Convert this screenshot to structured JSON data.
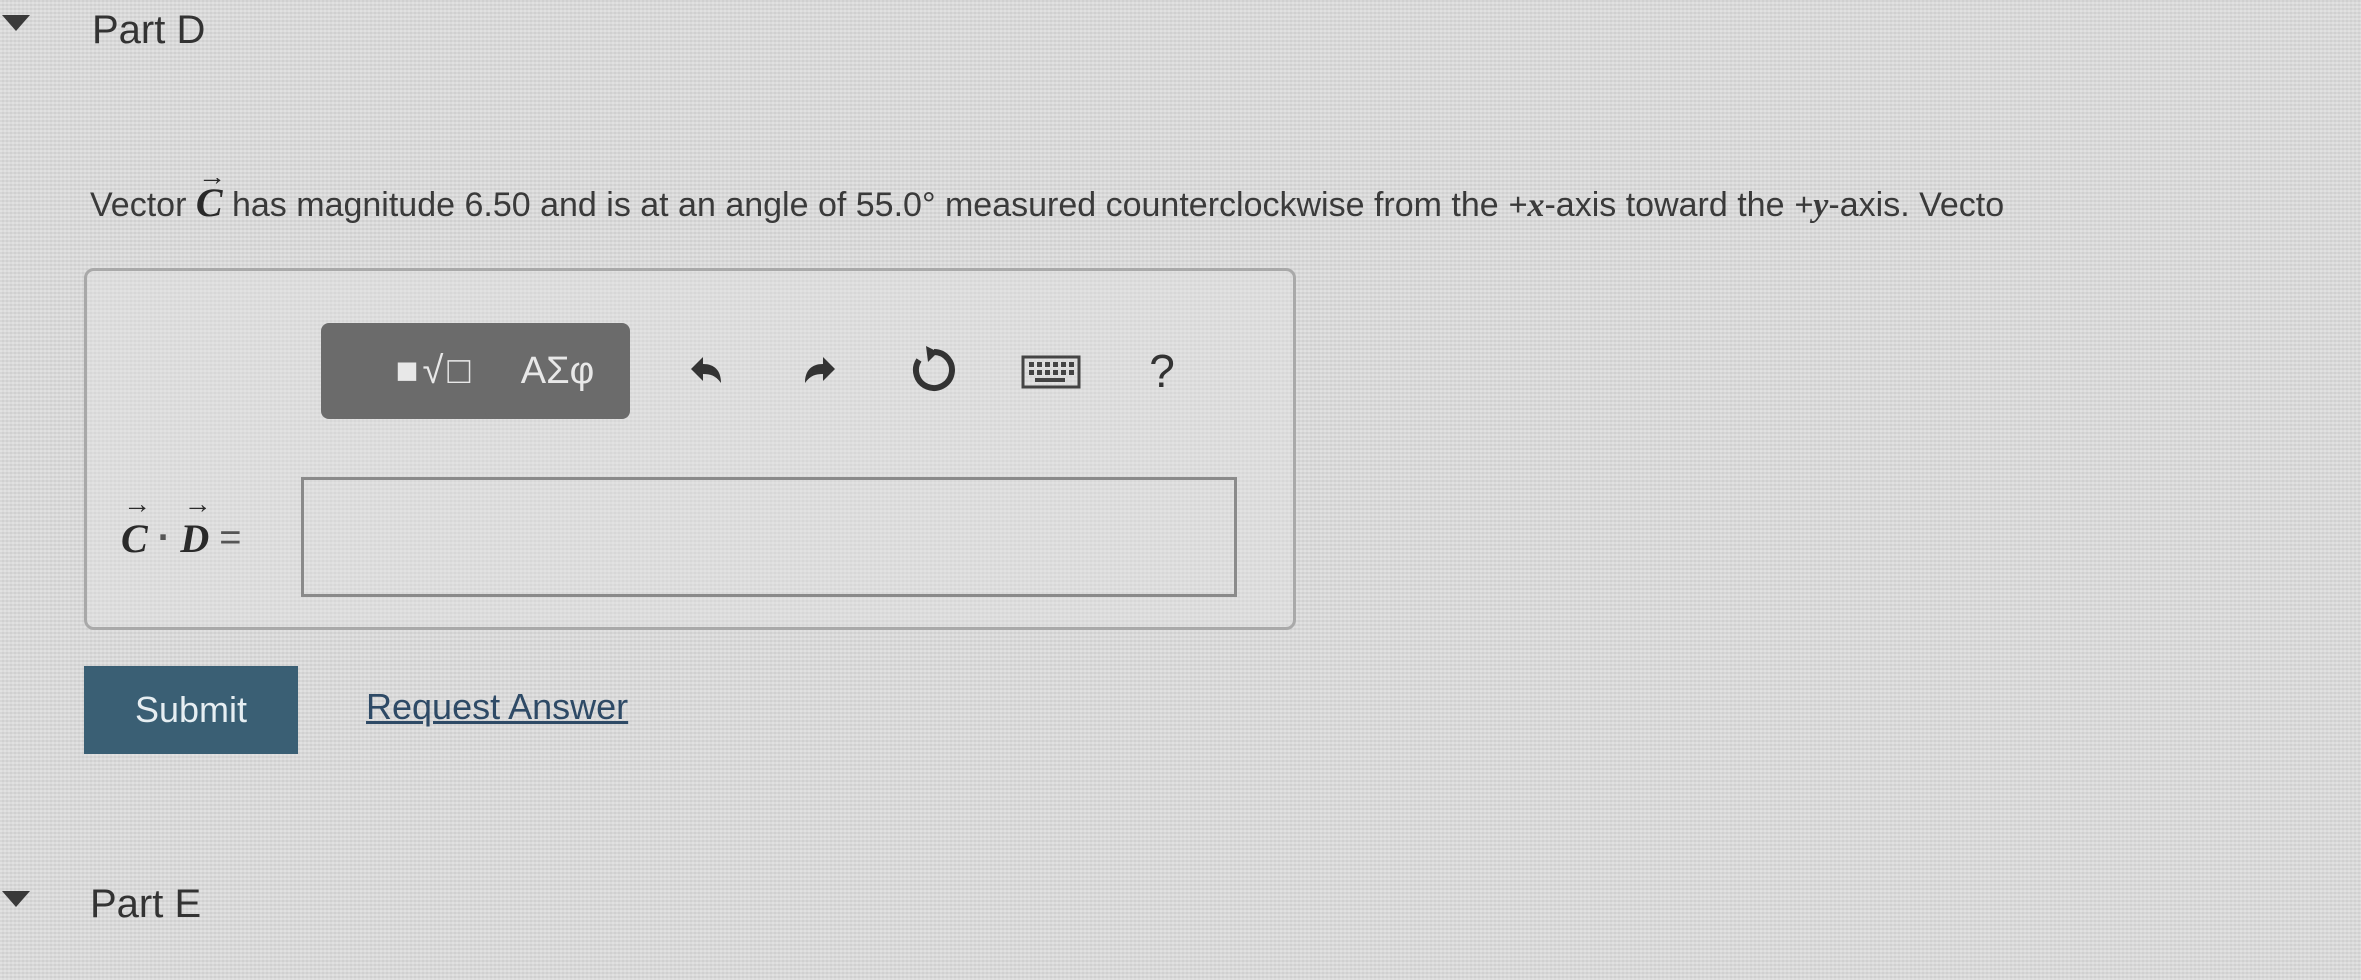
{
  "part_d": {
    "title": "Part D"
  },
  "question": {
    "segment1": "Vector ",
    "vector_c": "C",
    "segment2": " has magnitude 6.50 and is at an angle of 55.0° measured counterclockwise from the ",
    "plus_x": "+x",
    "segment3": "-axis toward the ",
    "plus_y": "+y",
    "segment4": "-axis. Vecto"
  },
  "toolbar": {
    "templates_label": "■√□",
    "greek_label": "ΑΣφ",
    "help_label": "?"
  },
  "answer": {
    "vector_c": "C",
    "dot": "·",
    "vector_d": "D",
    "equals": "=",
    "value": ""
  },
  "actions": {
    "submit_label": "Submit",
    "request_answer_label": "Request Answer"
  },
  "part_e": {
    "title": "Part E"
  },
  "colors": {
    "submit_bg": "#3a5f74",
    "toolbar_button_bg": "#6b6b6b",
    "link": "#2e4a66"
  },
  "icons": [
    "collapse-caret-icon",
    "undo-icon",
    "redo-icon",
    "reset-icon",
    "keyboard-icon",
    "help-icon"
  ]
}
